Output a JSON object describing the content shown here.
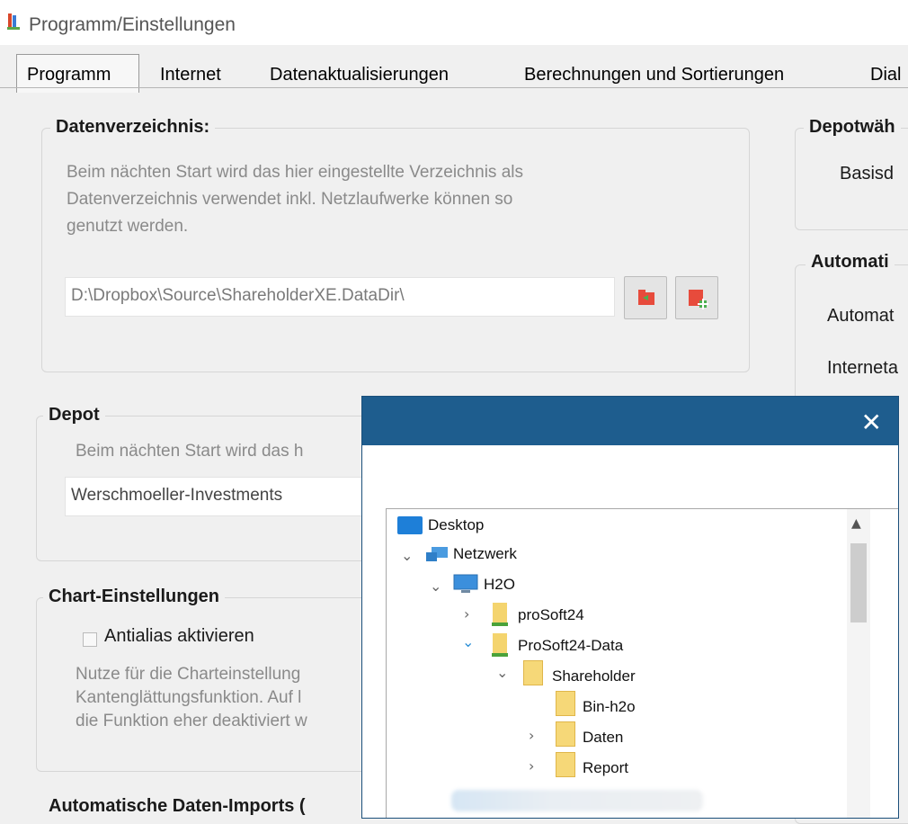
{
  "window": {
    "title": "Programm/Einstellungen"
  },
  "tabs": [
    {
      "label": "Programm",
      "active": true
    },
    {
      "label": "Internet"
    },
    {
      "label": "Datenaktualisierungen"
    },
    {
      "label": "Berechnungen und Sortierungen"
    },
    {
      "label": "Dial"
    }
  ],
  "datenverzeichnis": {
    "legend": "Datenverzeichnis:",
    "desc_lines": [
      "Beim nächten Start wird das hier eingestellte Verzeichnis als",
      "Datenverzeichnis verwendet inkl. Netzlaufwerke können so",
      "genutzt werden."
    ],
    "path_value": "D:\\Dropbox\\Source\\ShareholderXE.DataDir\\",
    "icons": [
      "folder-open-icon",
      "folder-add-icon"
    ]
  },
  "depot": {
    "legend": "Depot",
    "desc": "Beim nächten Start wird das h",
    "value": "Werschmoeller-Investments"
  },
  "chart": {
    "legend": "Chart-Einstellungen",
    "checkbox_label": "Antialias aktivieren",
    "desc_lines": [
      "Nutze für die Charteinstellung",
      "Kantenglättungsfunktion. Auf l",
      "die Funktion eher deaktiviert w"
    ]
  },
  "imports": {
    "legend": "Automatische Daten-Imports ("
  },
  "right_panel": {
    "depotwahl_legend": "Depotwäh",
    "depotwahl_text": "Basisd",
    "automati_legend": "Automati",
    "automat_label": "Automat",
    "interneta_label": "Interneta"
  },
  "dialog": {
    "close_glyph": "✕",
    "tree": [
      {
        "label": "Desktop",
        "icon": "desktop-icon"
      },
      {
        "label": "Netzwerk",
        "icon": "network-icon",
        "expanded": true
      },
      {
        "label": "H2O",
        "icon": "computer-icon",
        "expanded": true
      },
      {
        "label": "proSoft24",
        "icon": "network-drive-icon",
        "expanded": false
      },
      {
        "label": "ProSoft24-Data",
        "icon": "network-drive-icon",
        "expanded": true
      },
      {
        "label": "Shareholder",
        "icon": "folder-icon",
        "expanded": true
      },
      {
        "label": "Bin-h2o",
        "icon": "folder-icon"
      },
      {
        "label": "Daten",
        "icon": "folder-icon",
        "expanded": false
      },
      {
        "label": "Report",
        "icon": "folder-icon",
        "expanded": false
      }
    ]
  }
}
